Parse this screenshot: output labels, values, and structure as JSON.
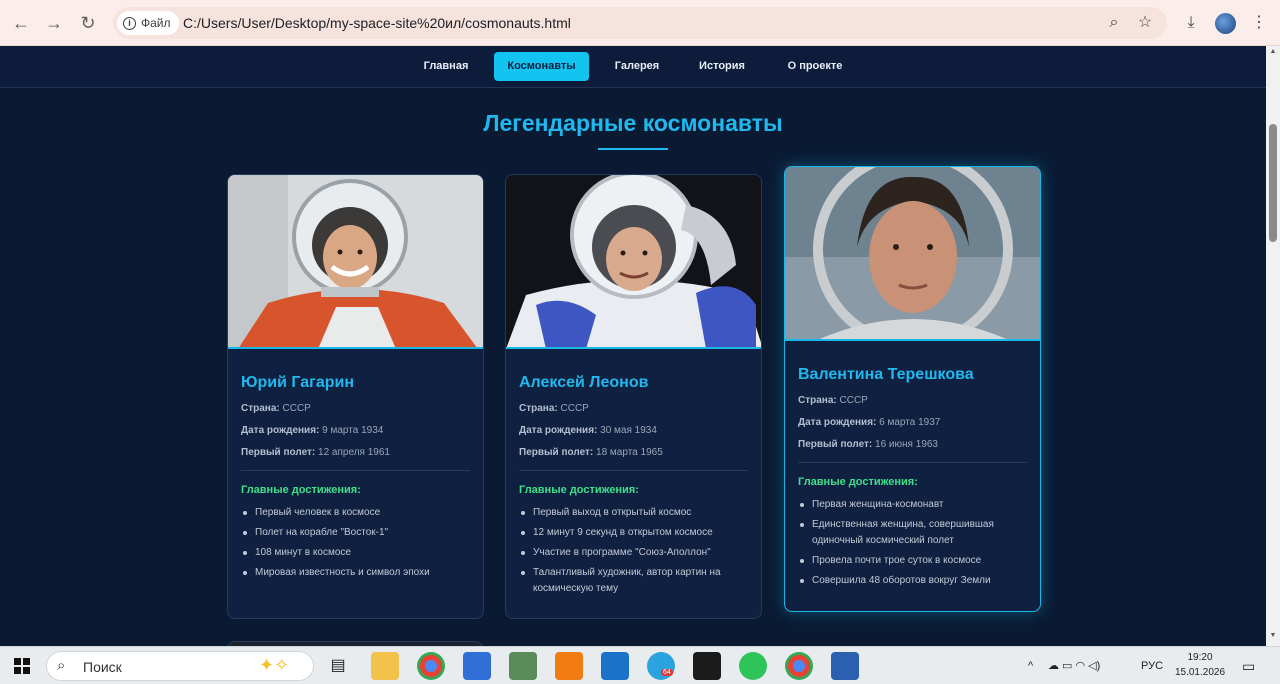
{
  "browser": {
    "file_label": "Файл",
    "url": "C:/Users/User/Desktop/my-space-site%20ил/cosmonauts.html"
  },
  "nav": {
    "items": [
      {
        "label": "Главная"
      },
      {
        "label": "Космонавты",
        "active": true
      },
      {
        "label": "Галерея"
      },
      {
        "label": "История"
      },
      {
        "label": "О проекте"
      }
    ]
  },
  "page": {
    "title": "Легендарные космонавты"
  },
  "labels": {
    "country": "Страна:",
    "birth": "Дата рождения:",
    "first_flight": "Первый полет:",
    "achievements": "Главные достижения:"
  },
  "cards": [
    {
      "name": "Юрий Гагарин",
      "country": "СССР",
      "birth": "9 марта 1934",
      "first_flight": "12 апреля 1961",
      "achievements": [
        "Первый человек в космосе",
        "Полет на корабле \"Восток-1\"",
        "108 минут в космосе",
        "Мировая известность и символ эпохи"
      ]
    },
    {
      "name": "Алексей Леонов",
      "country": "СССР",
      "birth": "30 мая 1934",
      "first_flight": "18 марта 1965",
      "achievements": [
        "Первый выход в открытый космос",
        "12 минут 9 секунд в открытом космосе",
        "Участие в программе \"Союз-Аполлон\"",
        "Талантливый художник, автор картин на космическую тему"
      ]
    },
    {
      "name": "Валентина Терешкова",
      "country": "СССР",
      "birth": "6 марта 1937",
      "first_flight": "16 июня 1963",
      "achievements": [
        "Первая женщина-космонавт",
        "Единственная женщина, совершившая одиночный космический полет",
        "Провела почти трое суток в космосе",
        "Совершила 48 оборотов вокруг Земли"
      ]
    }
  ],
  "taskbar": {
    "search_label": "Поиск",
    "language": "РУС",
    "time": "19:20",
    "date": "15.01.2026",
    "telegram_badge": "64"
  },
  "colors": {
    "accent": "#1fb9ef",
    "achievement_title": "#3fe08a",
    "page_bg": "#0a1a33"
  }
}
